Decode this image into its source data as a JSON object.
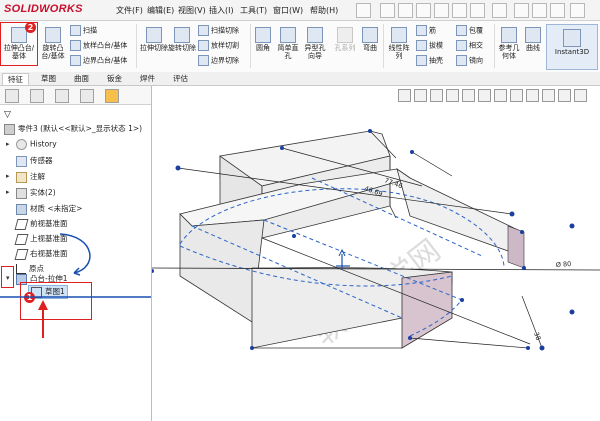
{
  "app": {
    "brand": "SOLIDWORKS"
  },
  "menus": [
    "文件(F)",
    "编辑(E)",
    "视图(V)",
    "插入(I)",
    "工具(T)",
    "窗口(W)",
    "帮助(H)"
  ],
  "ribbon": {
    "extrude_boss": "拉伸凸台/基体",
    "revolve_boss": "旋转凸台/基体",
    "sweep": "扫描",
    "loft": "放样凸台/基体",
    "boundary": "边界凸台/基体",
    "extrude_cut": "拉伸切除",
    "revolve_cut": "旋转切除",
    "swept_cut": "扫描切除",
    "loft_cut": "放样切割",
    "boundary_cut": "边界切除",
    "fillet": "圆角",
    "simple_hole": "简单直孔",
    "hole_wizard": "异型孔向导",
    "hole_series": "孔系列",
    "dome": "弯曲",
    "linear_pattern": "线性阵列",
    "rib": "筋",
    "draft": "拔模",
    "shell": "抽壳",
    "wrap": "包覆",
    "intersect": "相交",
    "mirror": "镜向",
    "ref_geometry": "参考几何体",
    "curves": "曲线",
    "instant3d": "Instant3D"
  },
  "tabs": [
    "特征",
    "草图",
    "曲面",
    "钣金",
    "焊件",
    "评估"
  ],
  "tree": {
    "root": "零件3 (默认<<默认>_显示状态 1>)",
    "items": [
      "History",
      "传感器",
      "注解",
      "实体(2)",
      "材质 <未指定>",
      "前视基准面",
      "上视基准面",
      "右视基准面",
      "原点",
      "凸台-拉伸1",
      "草图1"
    ]
  },
  "badges": {
    "one": "1",
    "two": "2"
  },
  "dimensions": {
    "d1": "77.46",
    "d2": "46.69",
    "d3": "Ø 80",
    "d4": "38"
  },
  "watermark": "软件自学网",
  "colors": {
    "annotation": "#e02020",
    "accent_blue": "#1a4fb0"
  }
}
